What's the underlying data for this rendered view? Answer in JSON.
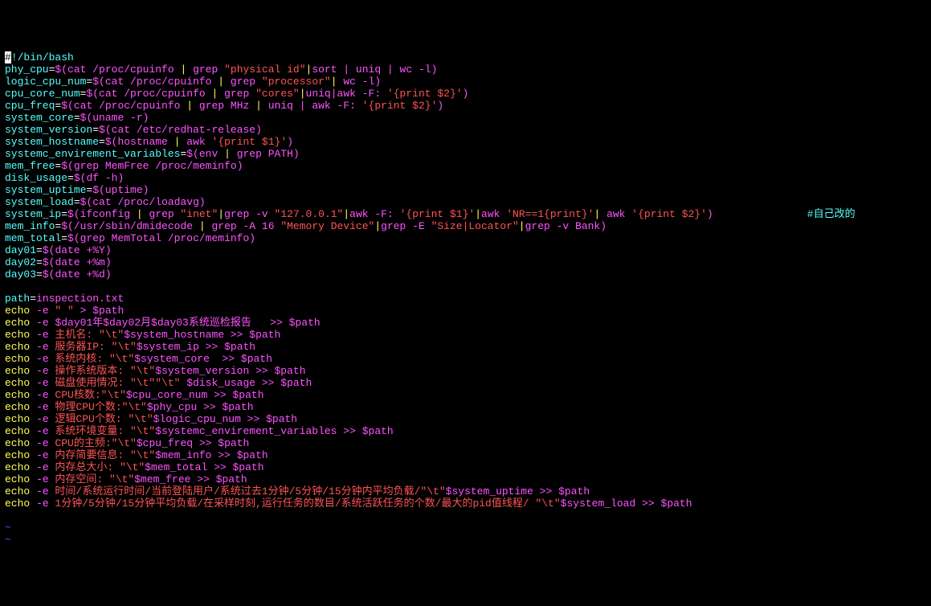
{
  "lines": {
    "l1_shebang": "!/bin/bash",
    "l2_var": "phy_cpu",
    "l2_cmd": "cat /proc/cpuinfo ",
    "l2_grep": "grep ",
    "l2_str": "\"physical id\"",
    "l2_rest": "sort | uniq | wc -l",
    "l3_var": "logic_cpu_num",
    "l3_cmd": "cat /proc/cpuinfo ",
    "l3_grep": "grep ",
    "l3_str": "\"processor\"",
    "l3_rest": " wc -l",
    "l4_var": "cpu_core_num",
    "l4_cmd": "cat /proc/cpuinfo ",
    "l4_grep": "grep ",
    "l4_str": "\"cores\"",
    "l4_rest": "uniq|awk -F: ",
    "l4_awk": "'{print $2}'",
    "l5_var": "cpu_freq",
    "l5_cmd": "cat /proc/cpuinfo ",
    "l5_grep": "grep MHz ",
    "l5_rest": " uniq | awk -F: ",
    "l5_awk": "'{print $2}'",
    "l6_var": "system_core",
    "l6_cmd": "uname -r",
    "l7_var": "system_version",
    "l7_cmd": "cat /etc/redhat-release",
    "l8_var": "system_hostname",
    "l8_cmd": "hostname ",
    "l8_awk": " awk ",
    "l8_str": "'{print $1}'",
    "l9_var": "systemc_envirement_variables",
    "l9_cmd": "env ",
    "l9_grep": " grep PATH",
    "l10_var": "mem_free",
    "l10_cmd": "grep MemFree /proc/meminfo",
    "l11_var": "disk_usage",
    "l11_cmd": "df -h",
    "l12_var": "system_uptime",
    "l12_cmd": "uptime",
    "l13_var": "system_load",
    "l13_cmd": "cat /proc/loadavg",
    "l14_var": "system_ip",
    "l14_cmd": "ifconfig ",
    "l14_grep1": " grep ",
    "l14_str1": "\"inet\"",
    "l14_grep2": "grep -v ",
    "l14_str2": "\"127.0.0.1\"",
    "l14_awk1": "awk -F: ",
    "l14_awkstr1": "'{print $1}'",
    "l14_awk2": "awk ",
    "l14_awkstr2": "'NR==1{print}'",
    "l14_awk3": " awk ",
    "l14_awkstr3": "'{print $2}'",
    "l14_comment": "#自己改的",
    "l15_var": "mem_info",
    "l15_cmd": "/usr/sbin/dmidecode ",
    "l15_grep1": " grep -A ",
    "l15_num": "16",
    "l15_str1": " \"Memory Device\"",
    "l15_grep2": "grep -E ",
    "l15_str2": "\"Size|Locator\"",
    "l15_grep3": "grep -v Bank",
    "l16_var": "mem_total",
    "l16_cmd": "grep MemTotal /proc/meminfo",
    "l17_var": "day01",
    "l17_cmd": "date +%Y",
    "l18_var": "day02",
    "l18_cmd": "date +%m",
    "l19_var": "day03",
    "l19_cmd": "date +%d",
    "l21_var": "path",
    "l21_val": "inspection.txt",
    "l22": "echo -e \" \" > $path",
    "e1_label": "$day01年$day02月$day03系统巡检报告  ",
    "e2_label": " 主机名: ",
    "e2_tab": "\"\\t\"",
    "e2_var": "$system_hostname",
    "e3_label": " 服务器IP: ",
    "e3_tab": "\"\\t\"",
    "e3_var": "$system_ip",
    "e4_label": " 系统内核: ",
    "e4_tab": "\"\\t\"",
    "e4_var": "$system_core ",
    "e5_label": " 操作系统版本: ",
    "e5_tab": "\"\\t\"",
    "e5_var": "$system_version",
    "e6_label": " 磁盘使用情况: ",
    "e6_tab": "\"\\t\"\"\\t\" ",
    "e6_var": "$disk_usage",
    "e7_label": " CPU核数:",
    "e7_tab": "\"\\t\"",
    "e7_var": "$cpu_core_num",
    "e8_label": " 物理CPU个数:",
    "e8_tab": "\"\\t\"",
    "e8_var": "$phy_cpu",
    "e9_label": " 逻辑CPU个数: ",
    "e9_tab": "\"\\t\"",
    "e9_var": "$logic_cpu_num",
    "e10_label": " 系统环境变量: ",
    "e10_tab": "\"\\t\"",
    "e10_var": "$systemc_envirement_variables",
    "e11_label": " CPU的主频:",
    "e11_tab": "\"\\t\"",
    "e11_var": "$cpu_freq",
    "e12_label": " 内存简要信息: ",
    "e12_tab": "\"\\t\"",
    "e12_var": "$mem_info",
    "e13_label": " 内存总大小: ",
    "e13_tab": "\"\\t\"",
    "e13_var": "$mem_total",
    "e14_label": " 内存空间: ",
    "e14_tab": "\"\\t\"",
    "e14_var": "$mem_free",
    "e15_label": " 时间/系统运行时间/当前登陆用户/系统过去1分钟/5分钟/15分钟内平均负载/",
    "e15_tab": "\"\\t\"",
    "e15_var": "$system_uptime",
    "e16_label": " 1分钟/5分钟/15分钟平均负载/在采样时刻,运行任务的数目/系统活跃任务的个数/最大的pid值线程/ ",
    "e16_tab": "\"\\t\"",
    "e16_var": "$system_load",
    "echo_cmd": "echo",
    "echo_opt": " -e",
    "redir": " >> ",
    "pathvar": "$path",
    "tilde": "~"
  }
}
